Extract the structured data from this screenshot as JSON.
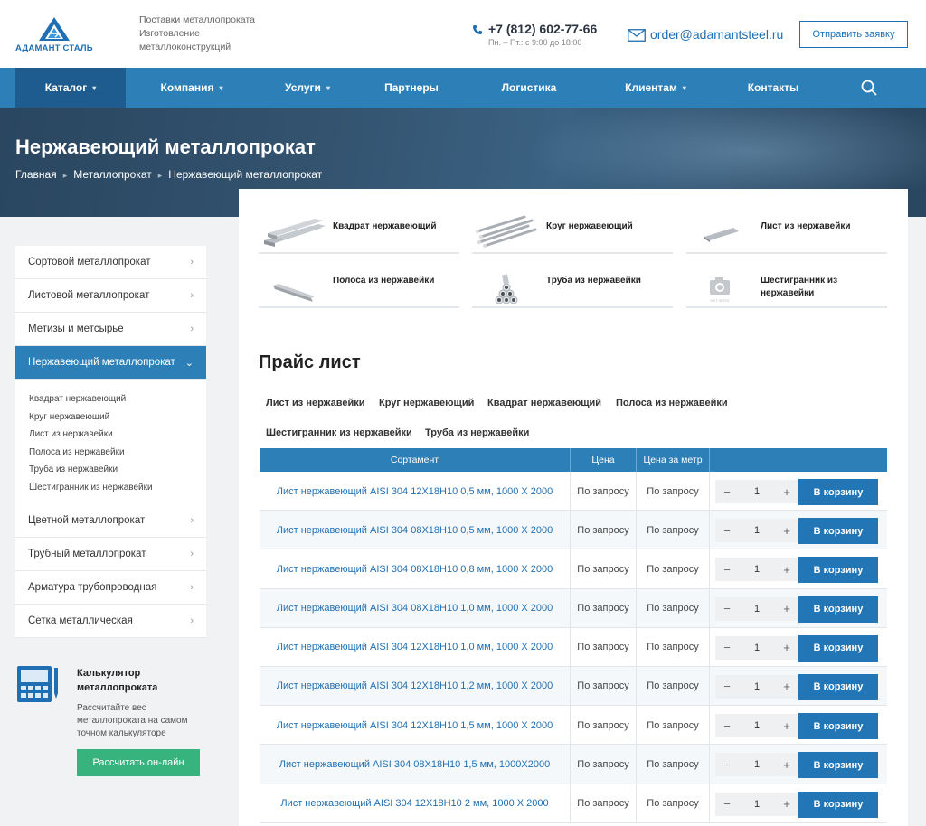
{
  "header": {
    "logo_text": "АДАМАНТ СТАЛЬ",
    "tagline": [
      "Поставки металлопроката",
      "Изготовление",
      "металлоконструкций"
    ],
    "phone": "+7 (812) 602-77-66",
    "hours": "Пн. – Пт.: с 9:00 до 18:00",
    "email": "order@adamantsteel.ru",
    "request_button": "Отправить заявку"
  },
  "nav": {
    "items": [
      {
        "label": "Каталог",
        "dropdown": true
      },
      {
        "label": "Компания",
        "dropdown": true
      },
      {
        "label": "Услуги",
        "dropdown": true
      },
      {
        "label": "Партнеры",
        "dropdown": false
      },
      {
        "label": "Логистика",
        "dropdown": false
      },
      {
        "label": "Клиентам",
        "dropdown": true
      },
      {
        "label": "Контакты",
        "dropdown": false
      }
    ]
  },
  "hero": {
    "title": "Нержавеющий металлопрокат",
    "breadcrumb": [
      "Главная",
      "Металлопрокат",
      "Нержавеющий металлопрокат"
    ]
  },
  "sidebar": {
    "items_top": [
      "Сортовой металлопрокат",
      "Листовой металлопрокат",
      "Метизы и метсырье"
    ],
    "active": "Нержавеющий металлопрокат",
    "sub_items": [
      "Квадрат нержавеющий",
      "Круг нержавеющий",
      "Лист из нержавейки",
      "Полоса из нержавейки",
      "Труба из нержавейки",
      "Шестигранник из нержавейки"
    ],
    "items_bottom": [
      "Цветной металлопрокат",
      "Трубный металлопрокат",
      "Арматура трубопроводная",
      "Сетка металлическая"
    ]
  },
  "calculator": {
    "title": "Калькулятор металлопроката",
    "description": "Рассчитайте вес металлопроката на самом точном калькуляторе",
    "button": "Рассчитать он-лайн"
  },
  "categories": [
    {
      "name": "Квадрат нержавеющий",
      "icon": "square-bar-image"
    },
    {
      "name": "Круг нержавеющий",
      "icon": "round-bar-image"
    },
    {
      "name": "Лист из нержавейки",
      "icon": "sheet-image"
    },
    {
      "name": "Полоса из нержавейки",
      "icon": "strip-image"
    },
    {
      "name": "Труба из нержавейки",
      "icon": "pipe-image"
    },
    {
      "name": "Шестигранник из нержавейки",
      "icon": "camera-icon"
    }
  ],
  "no_photo_label": "НЕТ ФОТО",
  "price_list": {
    "title": "Прайс лист",
    "filters": [
      "Лист из нержавейки",
      "Круг нержавеющий",
      "Квадрат нержавеющий",
      "Полоса из нержавейки",
      "Шестигранник из нержавейки",
      "Труба из нержавейки"
    ],
    "columns": [
      "Сортамент",
      "Цена",
      "Цена за метр",
      ""
    ],
    "cart_label": "В корзину",
    "minus": "−",
    "plus": "+",
    "rows": [
      {
        "name": "Лист нержавеющий AISI 304 12Х18Н10 0,5 мм, 1000 X 2000",
        "price": "По запросу",
        "price_m": "По запросу",
        "qty": "1"
      },
      {
        "name": "Лист нержавеющий AISI 304 08Х18Н10 0,5 мм, 1000 X 2000",
        "price": "По запросу",
        "price_m": "По запросу",
        "qty": "1"
      },
      {
        "name": "Лист нержавеющий AISI 304 08Х18Н10 0,8 мм, 1000 X 2000",
        "price": "По запросу",
        "price_m": "По запросу",
        "qty": "1"
      },
      {
        "name": "Лист нержавеющий AISI 304 08Х18Н10 1,0 мм, 1000 X 2000",
        "price": "По запросу",
        "price_m": "По запросу",
        "qty": "1"
      },
      {
        "name": "Лист нержавеющий AISI 304 12Х18Н10 1,0 мм, 1000 X 2000",
        "price": "По запросу",
        "price_m": "По запросу",
        "qty": "1"
      },
      {
        "name": "Лист нержавеющий AISI 304 12Х18Н10 1,2 мм, 1000 X 2000",
        "price": "По запросу",
        "price_m": "По запросу",
        "qty": "1"
      },
      {
        "name": "Лист нержавеющий AISI 304 12Х18Н10 1,5 мм, 1000 X 2000",
        "price": "По запросу",
        "price_m": "По запросу",
        "qty": "1"
      },
      {
        "name": "Лист нержавеющий AISI 304 08Х18Н10 1,5 мм, 1000X2000",
        "price": "По запросу",
        "price_m": "По запросу",
        "qty": "1"
      },
      {
        "name": "Лист нержавеющий AISI 304 12Х18Н10 2 мм, 1000 X 2000",
        "price": "По запросу",
        "price_m": "По запросу",
        "qty": "1"
      }
    ]
  }
}
